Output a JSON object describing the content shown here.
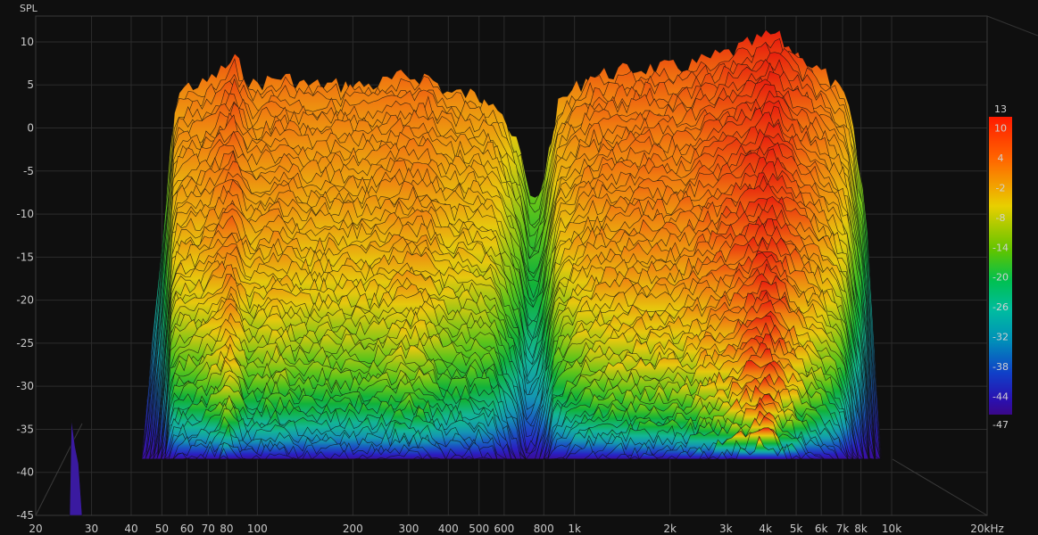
{
  "chart_data": {
    "type": "area",
    "style": "3d waterfall spectral decay",
    "ylabel": "SPL",
    "y_ticks": [
      "10",
      "5",
      "0",
      "-5",
      "-10",
      "-15",
      "-20",
      "-25",
      "-30",
      "-35",
      "-40",
      "-45"
    ],
    "ylim": [
      -45,
      13
    ],
    "x_scale": "log",
    "x_ticks": [
      {
        "label": "20",
        "value": 20
      },
      {
        "label": "30",
        "value": 30
      },
      {
        "label": "40",
        "value": 40
      },
      {
        "label": "50",
        "value": 50
      },
      {
        "label": "60",
        "value": 60
      },
      {
        "label": "70",
        "value": 70
      },
      {
        "label": "80",
        "value": 80
      },
      {
        "label": "100",
        "value": 100
      },
      {
        "label": "200",
        "value": 200
      },
      {
        "label": "300",
        "value": 300
      },
      {
        "label": "400",
        "value": 400
      },
      {
        "label": "500",
        "value": 500
      },
      {
        "label": "600",
        "value": 600
      },
      {
        "label": "800",
        "value": 800
      },
      {
        "label": "1k",
        "value": 1000
      },
      {
        "label": "2k",
        "value": 2000
      },
      {
        "label": "3k",
        "value": 3000
      },
      {
        "label": "4k",
        "value": 4000
      },
      {
        "label": "5k",
        "value": 5000
      },
      {
        "label": "6k",
        "value": 6000
      },
      {
        "label": "7k",
        "value": 7000
      },
      {
        "label": "8k",
        "value": 8000
      },
      {
        "label": "10k",
        "value": 10000
      },
      {
        "label": "20kHz",
        "value": 20000
      }
    ],
    "xlim": [
      20,
      20000
    ],
    "colorbar": {
      "labels": [
        "13",
        "10",
        "4",
        "-2",
        "-8",
        "-14",
        "-20",
        "-26",
        "-32",
        "-38",
        "-44",
        "-47"
      ],
      "range": [
        -47,
        13
      ]
    },
    "front_response": [
      {
        "f": 35,
        "spl": -36
      },
      {
        "f": 40,
        "spl": -15
      },
      {
        "f": 45,
        "spl": 5
      },
      {
        "f": 50,
        "spl": 6
      },
      {
        "f": 55,
        "spl": 6
      },
      {
        "f": 60,
        "spl": 7
      },
      {
        "f": 65,
        "spl": 8
      },
      {
        "f": 70,
        "spl": 9
      },
      {
        "f": 80,
        "spl": 6
      },
      {
        "f": 100,
        "spl": 7
      },
      {
        "f": 120,
        "spl": 6
      },
      {
        "f": 150,
        "spl": 6
      },
      {
        "f": 200,
        "spl": 6
      },
      {
        "f": 250,
        "spl": 7
      },
      {
        "f": 300,
        "spl": 7
      },
      {
        "f": 350,
        "spl": 5
      },
      {
        "f": 400,
        "spl": 5
      },
      {
        "f": 500,
        "spl": 4
      },
      {
        "f": 600,
        "spl": -2
      },
      {
        "f": 650,
        "spl": -8
      },
      {
        "f": 700,
        "spl": -6
      },
      {
        "f": 800,
        "spl": 4
      },
      {
        "f": 1000,
        "spl": 7
      },
      {
        "f": 1500,
        "spl": 8
      },
      {
        "f": 2000,
        "spl": 8
      },
      {
        "f": 3000,
        "spl": 10
      },
      {
        "f": 4000,
        "spl": 12
      },
      {
        "f": 5000,
        "spl": 9
      },
      {
        "f": 6000,
        "spl": 7
      },
      {
        "f": 7000,
        "spl": 4
      },
      {
        "f": 8000,
        "spl": -8
      },
      {
        "f": 9000,
        "spl": -37
      }
    ],
    "slices": 60,
    "grid": true
  }
}
